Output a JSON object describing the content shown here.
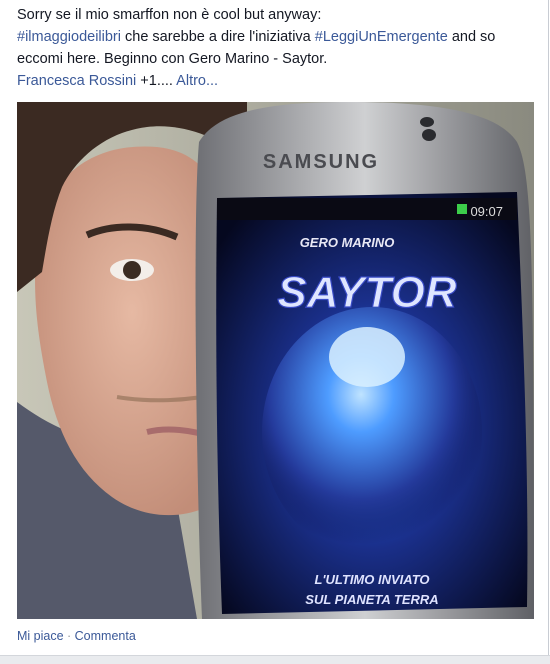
{
  "post": {
    "line1": "Sorry se il mio smarffon non è cool but anyway:",
    "hashtag1": "#ilmaggiodeilibri",
    "mid_text": " che sarebbe a dire l'iniziativa ",
    "hashtag2": "#LeggiUnEmergente",
    "tail_text": " and so eccomi here. Beginno con Gero Marino - Saytor."
  },
  "meta": {
    "author": "Francesca Rossini",
    "plus": " +1.... ",
    "more": "Altro..."
  },
  "photo": {
    "phone_brand": "SAMSUNG",
    "status_time": "09:07",
    "book_author": "GERO MARINO",
    "book_title": "SAYTOR",
    "subtitle_line1": "L'ULTIMO INVIATO",
    "subtitle_line2": "SUL PIANETA TERRA"
  },
  "footer": {
    "like": "Mi piace",
    "separator": " · ",
    "comment": "Commenta"
  },
  "colors": {
    "link": "#3b5998",
    "text": "#141823",
    "muted": "#90949c"
  }
}
